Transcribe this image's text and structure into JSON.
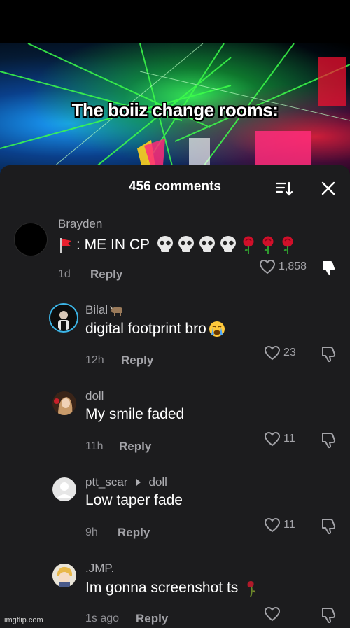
{
  "video": {
    "caption": "The boiiz change rooms:"
  },
  "sheet": {
    "comment_count": "456 comments"
  },
  "comments": [
    {
      "username": "Brayden",
      "text": ": ME IN CP",
      "time": "1d",
      "reply_label": "Reply",
      "likes": "1,858"
    },
    {
      "username": "Bilal",
      "text": "digital footprint bro",
      "time": "12h",
      "reply_label": "Reply",
      "likes": "23"
    },
    {
      "username": "doll",
      "text": "My smile faded",
      "time": "11h",
      "reply_label": "Reply",
      "likes": "11"
    },
    {
      "username": "ptt_scar",
      "reply_to": "doll",
      "text": "Low taper fade",
      "time": "9h",
      "reply_label": "Reply",
      "likes": "11"
    },
    {
      "username": ".JMP.",
      "text": "Im gonna screenshot ts",
      "time": "1s ago",
      "reply_label": "Reply",
      "likes": ""
    }
  ],
  "watermark": "imgflip.com",
  "colors": {
    "sheet_bg": "#1c1c1e",
    "muted_text": "#aeaeb2",
    "verified_ring": "#3cb4e6",
    "rose": "#d0102a"
  },
  "icons": [
    "sort-icon",
    "close-icon",
    "heart-icon",
    "dislike-icon",
    "skull-icon",
    "rose-icon",
    "flag-icon",
    "crying-face-icon",
    "goat-icon",
    "wilted-rose-icon",
    "reply-arrow-icon"
  ]
}
